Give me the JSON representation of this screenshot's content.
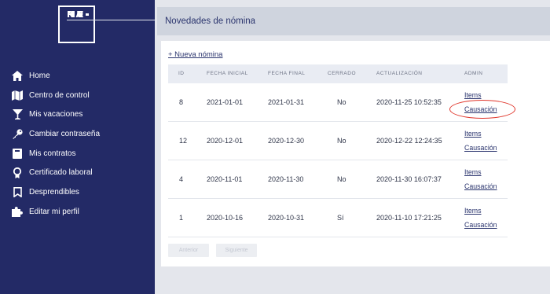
{
  "logo": {
    "line1": "NU",
    "line2": "ME",
    "line3": "RA"
  },
  "sidebar": {
    "items": [
      {
        "label": "Home",
        "icon": "home-icon"
      },
      {
        "label": "Centro de control",
        "icon": "map-icon"
      },
      {
        "label": "Mis vacaciones",
        "icon": "cocktail-icon"
      },
      {
        "label": "Cambiar contraseña",
        "icon": "key-icon"
      },
      {
        "label": "Mis contratos",
        "icon": "book-icon"
      },
      {
        "label": "Certificado laboral",
        "icon": "ribbon-icon"
      },
      {
        "label": "Desprendibles",
        "icon": "bookmark-icon"
      },
      {
        "label": "Editar mi perfil",
        "icon": "puzzle-icon"
      }
    ]
  },
  "header": {
    "title": "Novedades de nómina"
  },
  "main": {
    "new_link": "+ Nueva nómina",
    "columns": [
      "ID",
      "FECHA INICIAL",
      "FECHA FINAL",
      "CERRADO",
      "ACTUALIZACIÓN",
      "ADMIN"
    ],
    "rows": [
      {
        "id": "8",
        "start": "2021-01-01",
        "end": "2021-01-31",
        "closed": "No",
        "updated": "2020-11-25 10:52:35",
        "items": "Items",
        "causacion": "Causación"
      },
      {
        "id": "12",
        "start": "2020-12-01",
        "end": "2020-12-30",
        "closed": "No",
        "updated": "2020-12-22 12:24:35",
        "items": "Items",
        "causacion": "Causación"
      },
      {
        "id": "4",
        "start": "2020-11-01",
        "end": "2020-11-30",
        "closed": "No",
        "updated": "2020-11-30 16:07:37",
        "items": "Items",
        "causacion": "Causación"
      },
      {
        "id": "1",
        "start": "2020-10-16",
        "end": "2020-10-31",
        "closed": "Sí",
        "updated": "2020-11-10 17:21:25",
        "items": "Items",
        "causacion": "Causación"
      }
    ],
    "prev_label": "Anterior",
    "next_label": "Siguiente"
  },
  "colors": {
    "sidebar": "#232a66",
    "accent": "#2b356e",
    "highlight": "#e0362b"
  }
}
